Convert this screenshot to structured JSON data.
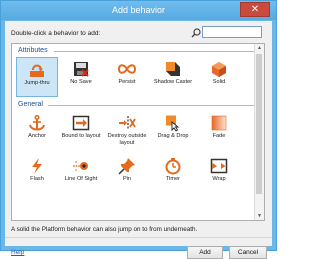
{
  "window": {
    "title": "Add behavior",
    "close_glyph": "✕"
  },
  "prompt": "Double-click a behavior to add:",
  "search": {
    "value": "",
    "placeholder": ""
  },
  "groups": [
    {
      "label": "Attributes",
      "items": [
        {
          "label": "Jump-thru",
          "icon": "jump-thru-icon",
          "selected": true
        },
        {
          "label": "No Save",
          "icon": "no-save-icon",
          "selected": false
        },
        {
          "label": "Persist",
          "icon": "persist-icon",
          "selected": false
        },
        {
          "label": "Shadow Caster",
          "icon": "shadow-caster-icon",
          "selected": false
        },
        {
          "label": "Solid",
          "icon": "solid-icon",
          "selected": false
        }
      ]
    },
    {
      "label": "General",
      "items": [
        {
          "label": "Anchor",
          "icon": "anchor-icon"
        },
        {
          "label": "Bound to layout",
          "icon": "bound-to-layout-icon"
        },
        {
          "label": "Destroy outside layout",
          "icon": "destroy-outside-layout-icon"
        },
        {
          "label": "Drag & Drop",
          "icon": "drag-drop-icon"
        },
        {
          "label": "Fade",
          "icon": "fade-icon"
        },
        {
          "label": "Flash",
          "icon": "flash-icon"
        },
        {
          "label": "Line Of Sight",
          "icon": "line-of-sight-icon"
        },
        {
          "label": "Pin",
          "icon": "pin-icon"
        },
        {
          "label": "Timer",
          "icon": "timer-icon"
        },
        {
          "label": "Wrap",
          "icon": "wrap-icon"
        }
      ]
    }
  ],
  "description": "A solid the Platform behavior can also jump on to from underneath.",
  "footer": {
    "help": "Help",
    "add": "Add",
    "cancel": "Cancel"
  },
  "scroll": {
    "up": "▲",
    "down": "▼"
  },
  "colors": {
    "accent": "#1c4f8e",
    "titlebar": "#57a9e0",
    "close": "#c94b3e",
    "selection": "#cde6f7"
  }
}
